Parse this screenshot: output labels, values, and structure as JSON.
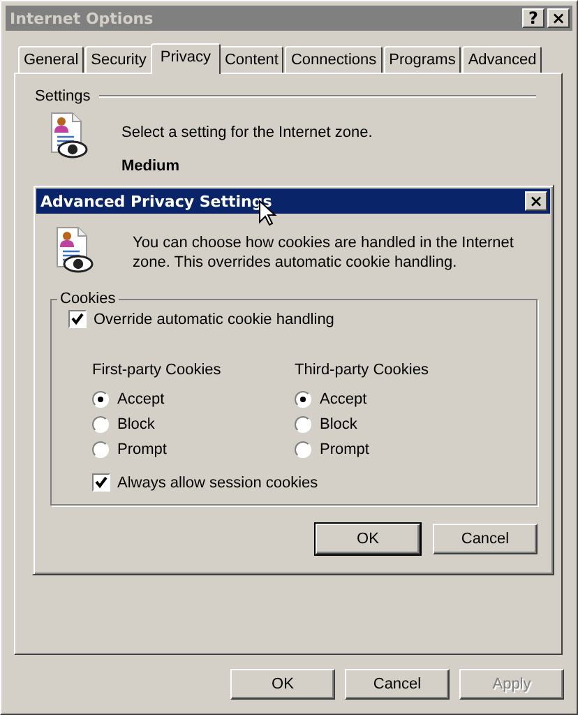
{
  "window": {
    "title": "Internet Options",
    "title_buttons": [
      "?",
      "×"
    ]
  },
  "tabs": [
    {
      "label": "General",
      "selected": false
    },
    {
      "label": "Security",
      "selected": false
    },
    {
      "label": "Privacy",
      "selected": true
    },
    {
      "label": "Content",
      "selected": false
    },
    {
      "label": "Connections",
      "selected": false
    },
    {
      "label": "Programs",
      "selected": false
    },
    {
      "label": "Advanced",
      "selected": false
    }
  ],
  "privacy": {
    "section": "Settings",
    "description": "Select a setting for the Internet zone.",
    "level_name": "Medium"
  },
  "dialog": {
    "title": "Advanced Privacy Settings",
    "close": "×",
    "description": "You can choose how cookies are handled in the Internet zone.  This overrides automatic cookie handling.",
    "group": "Cookies",
    "override": {
      "label": "Override automatic cookie handling",
      "checked": true
    },
    "columns": [
      {
        "heading": "First-party Cookies",
        "options": [
          {
            "label": "Accept",
            "selected": true
          },
          {
            "label": "Block",
            "selected": false
          },
          {
            "label": "Prompt",
            "selected": false
          }
        ]
      },
      {
        "heading": "Third-party Cookies",
        "options": [
          {
            "label": "Accept",
            "selected": true
          },
          {
            "label": "Block",
            "selected": false
          },
          {
            "label": "Prompt",
            "selected": false
          }
        ]
      }
    ],
    "session": {
      "label": "Always allow session cookies",
      "checked": true
    },
    "buttons": [
      {
        "label": "OK",
        "default": true
      },
      {
        "label": "Cancel",
        "default": false
      }
    ]
  },
  "buttons": [
    {
      "label": "OK",
      "disabled": false
    },
    {
      "label": "Cancel",
      "disabled": false
    },
    {
      "label": "Apply",
      "disabled": true
    }
  ]
}
